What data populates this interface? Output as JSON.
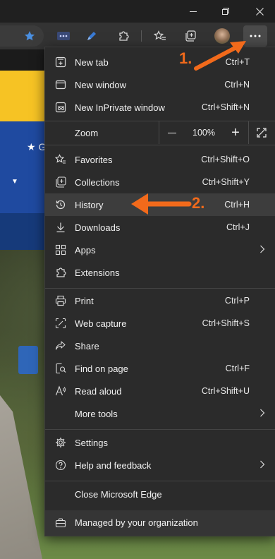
{
  "colors": {
    "accent_orange": "#f26a1b",
    "menu_bg": "#2b2b2b",
    "highlight_bg": "#3d3d3d",
    "yellow_banner": "#f6c324",
    "blue_banner": "#1f4aa0"
  },
  "window": {
    "minimize_icon": "minimize-icon",
    "restore_icon": "restore-icon",
    "close_icon": "close-icon"
  },
  "toolbar": {
    "icons": [
      "favorite-star-icon",
      "extension-dots-icon",
      "pen-icon",
      "extensions-puzzle-icon",
      "favorites-icon",
      "collections-icon",
      "profile-avatar",
      "settings-more-icon"
    ]
  },
  "page_bg": {
    "nav_text": "G"
  },
  "menu": {
    "new_tab": {
      "label": "New tab",
      "shortcut": "Ctrl+T"
    },
    "new_window": {
      "label": "New window",
      "shortcut": "Ctrl+N"
    },
    "new_inprivate": {
      "label": "New InPrivate window",
      "shortcut": "Ctrl+Shift+N"
    },
    "zoom": {
      "label": "Zoom",
      "value": "100%",
      "minus": "—",
      "plus": "+"
    },
    "favorites": {
      "label": "Favorites",
      "shortcut": "Ctrl+Shift+O"
    },
    "collections": {
      "label": "Collections",
      "shortcut": "Ctrl+Shift+Y"
    },
    "history": {
      "label": "History",
      "shortcut": "Ctrl+H"
    },
    "downloads": {
      "label": "Downloads",
      "shortcut": "Ctrl+J"
    },
    "apps": {
      "label": "Apps"
    },
    "extensions": {
      "label": "Extensions"
    },
    "print": {
      "label": "Print",
      "shortcut": "Ctrl+P"
    },
    "web_capture": {
      "label": "Web capture",
      "shortcut": "Ctrl+Shift+S"
    },
    "share": {
      "label": "Share"
    },
    "find_on_page": {
      "label": "Find on page",
      "shortcut": "Ctrl+F"
    },
    "read_aloud": {
      "label": "Read aloud",
      "shortcut": "Ctrl+Shift+U"
    },
    "more_tools": {
      "label": "More tools"
    },
    "settings": {
      "label": "Settings"
    },
    "help": {
      "label": "Help and feedback"
    },
    "close_edge": {
      "label": "Close Microsoft Edge"
    },
    "managed": {
      "label": "Managed by your organization"
    }
  },
  "annotations": {
    "step1": "1.",
    "step2": "2."
  }
}
